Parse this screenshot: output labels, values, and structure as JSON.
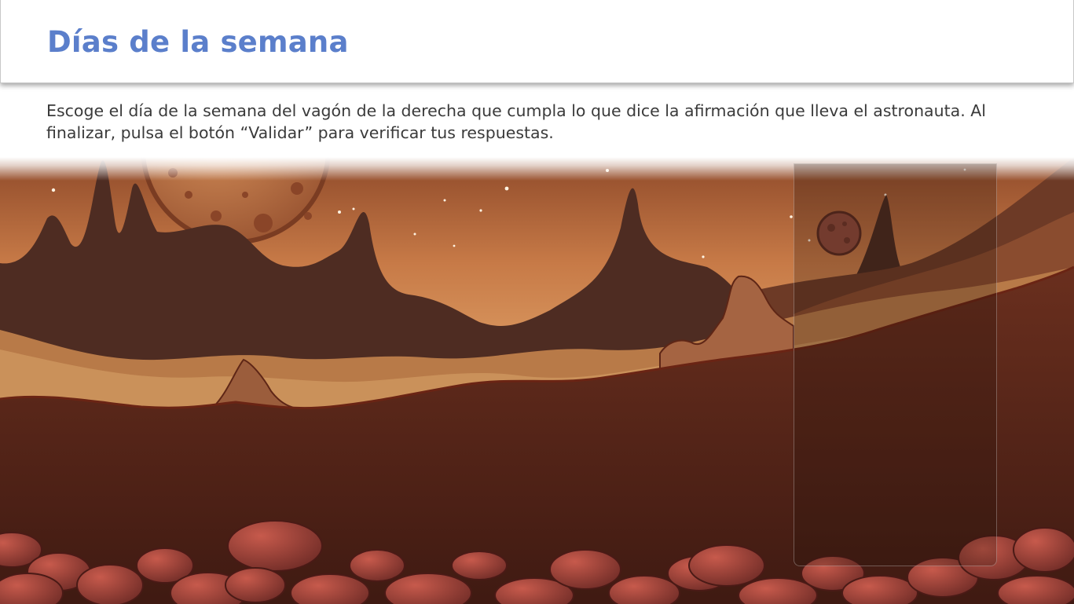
{
  "header": {
    "title": "Días de la semana"
  },
  "instructions": {
    "text": "Escoge el día de la semana del vagón de la derecha que cumpla lo que dice la afirmación que lleva el astronauta. Al finalizar, pulsa el botón “Validar” para verificar tus respuestas."
  },
  "colors": {
    "title": "#5b7fcb",
    "text": "#3a3a3a",
    "sky_top": "#8f4a2a",
    "sky_bottom": "#e2a56a",
    "ground": "#4d2117"
  },
  "scene": {
    "icons": [
      "planet-icon",
      "asteroid-icon",
      "mountains",
      "rocks"
    ]
  }
}
